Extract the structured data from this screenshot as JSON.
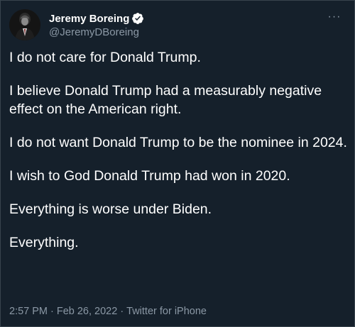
{
  "colors": {
    "background": "#15202b",
    "text": "#ffffff",
    "secondary_text": "#8b98a5",
    "verified_badge": "#ffffff"
  },
  "author": {
    "display_name": "Jeremy Boreing",
    "handle": "@JeremyDBoreing",
    "verified_icon": "verified-badge-icon",
    "avatar_icon": "profile-photo"
  },
  "menu": {
    "more_icon": "···"
  },
  "tweet": {
    "paragraphs": [
      "I do not care for Donald Trump.",
      "I believe Donald Trump had a measurably negative effect on the American right.",
      "I do not want Donald Trump to be the nominee in 2024.",
      "I wish to God Donald Trump had won in 2020.",
      "Everything is worse under Biden.",
      "Everything."
    ]
  },
  "meta": {
    "time": "2:57 PM",
    "date": "Feb 26, 2022",
    "separator": "·",
    "source": "Twitter for iPhone"
  }
}
